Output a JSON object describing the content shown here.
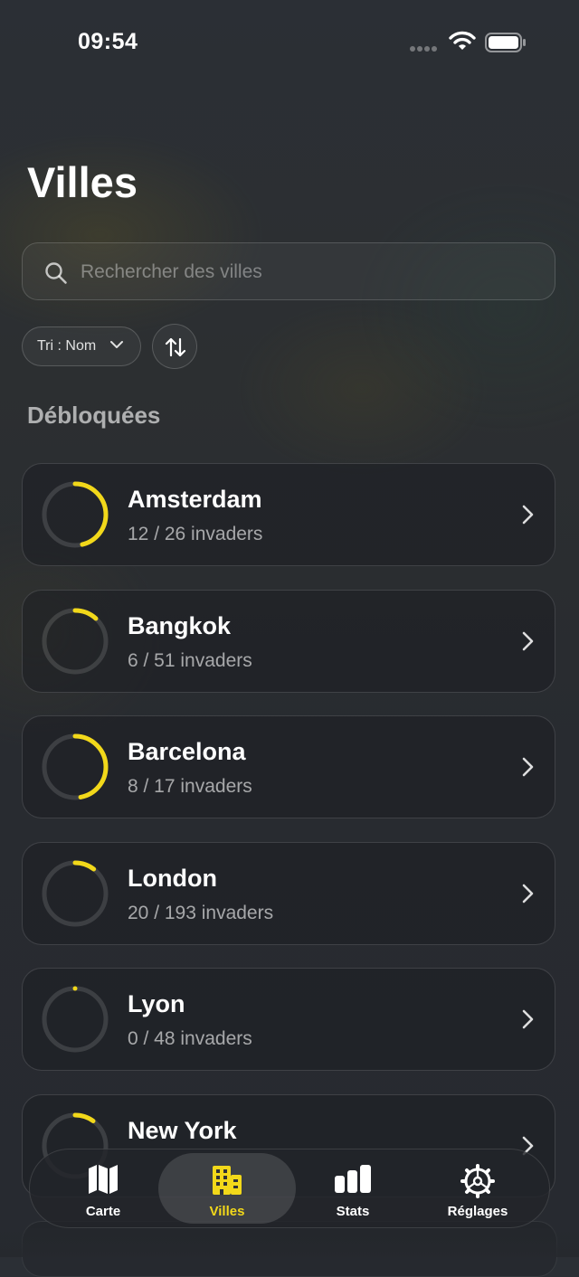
{
  "status_bar": {
    "time": "09:54"
  },
  "page": {
    "title": "Villes"
  },
  "search": {
    "placeholder": "Rechercher des villes",
    "value": ""
  },
  "sort": {
    "label": "Tri : Nom"
  },
  "section": {
    "title": "Débloquées"
  },
  "accent_color": "#F2D81A",
  "cities": [
    {
      "name": "Amsterdam",
      "count_text": "12 / 26 invaders",
      "found": 12,
      "total": 26
    },
    {
      "name": "Bangkok",
      "count_text": "6 / 51 invaders",
      "found": 6,
      "total": 51
    },
    {
      "name": "Barcelona",
      "count_text": "8 / 17 invaders",
      "found": 8,
      "total": 17
    },
    {
      "name": "London",
      "count_text": "20 / 193 invaders",
      "found": 20,
      "total": 193
    },
    {
      "name": "Lyon",
      "count_text": "0 / 48 invaders",
      "found": 0,
      "total": 48
    },
    {
      "name": "New York",
      "count_text": "",
      "found": 1,
      "total": 10
    }
  ],
  "tabs": [
    {
      "label": "Carte",
      "icon": "map-icon",
      "active": false
    },
    {
      "label": "Villes",
      "icon": "buildings-icon",
      "active": true
    },
    {
      "label": "Stats",
      "icon": "bar-chart-icon",
      "active": false
    },
    {
      "label": "Réglages",
      "icon": "gear-icon",
      "active": false
    }
  ]
}
